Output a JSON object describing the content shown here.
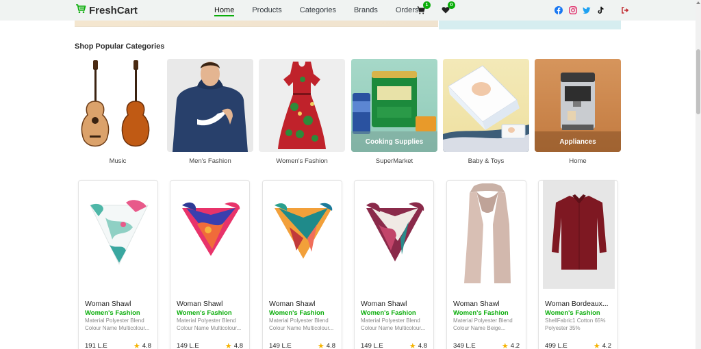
{
  "brand": {
    "name": "FreshCart",
    "color": "#0aad0a"
  },
  "nav": {
    "links": [
      "Home",
      "Products",
      "Categories",
      "Brands",
      "Orders"
    ],
    "active_index": 0,
    "cart_count": "1",
    "wishlist_count": "0"
  },
  "social": [
    "facebook-icon",
    "instagram-icon",
    "twitter-icon",
    "tiktok-icon"
  ],
  "categories_section": {
    "title": "Shop Popular Categories",
    "items": [
      {
        "label": "Music",
        "overlay": ""
      },
      {
        "label": "Men's Fashion",
        "overlay": ""
      },
      {
        "label": "Women's Fashion",
        "overlay": ""
      },
      {
        "label": "SuperMarket",
        "overlay": "Cooking Supplies"
      },
      {
        "label": "Baby & Toys",
        "overlay": ""
      },
      {
        "label": "Home",
        "overlay": "Appliances"
      }
    ]
  },
  "products": [
    {
      "title": "Woman Shawl",
      "category": "Women's Fashion",
      "desc1": "Material Polyester Blend",
      "desc2": "Colour Name Multicolour...",
      "price": "191 L.E",
      "rating": "4.8"
    },
    {
      "title": "Woman Shawl",
      "category": "Women's Fashion",
      "desc1": "Material Polyester Blend",
      "desc2": "Colour Name Multicolour...",
      "price": "149 L.E",
      "rating": "4.8"
    },
    {
      "title": "Woman Shawl",
      "category": "Women's Fashion",
      "desc1": "Material Polyester Blend",
      "desc2": "Colour Name Multicolour...",
      "price": "149 L.E",
      "rating": "4.8"
    },
    {
      "title": "Woman Shawl",
      "category": "Women's Fashion",
      "desc1": "Material Polyester Blend",
      "desc2": "Colour Name Multicolour...",
      "price": "149 L.E",
      "rating": "4.8"
    },
    {
      "title": "Woman Shawl",
      "category": "Women's Fashion",
      "desc1": "Material Polyester Blend",
      "desc2": "Colour Name Beige...",
      "price": "349 L.E",
      "rating": "4.2"
    },
    {
      "title": "Woman Bordeaux...",
      "category": "Women's Fashion",
      "desc1": "ShellFabric1 Cotton 65%",
      "desc2": "Polyester 35%",
      "price": "499 L.E",
      "rating": "4.2"
    }
  ]
}
